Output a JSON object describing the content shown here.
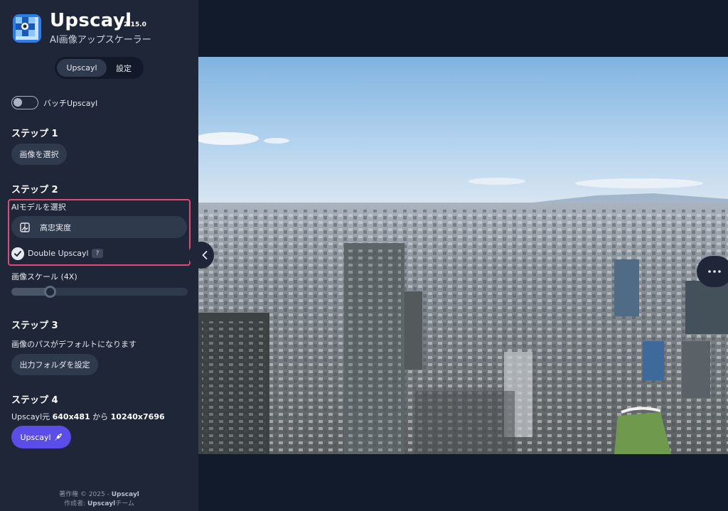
{
  "app": {
    "title": "Upscayl",
    "version": "2.15.0",
    "subtitle": "AI画像アップスケーラー"
  },
  "tabs": [
    {
      "label": "Upscayl",
      "active": true
    },
    {
      "label": "設定",
      "active": false
    }
  ],
  "batch": {
    "label": "バッチUpscayl",
    "enabled": false
  },
  "step1": {
    "title": "ステップ 1",
    "button": "画像を選択"
  },
  "step2": {
    "title": "ステップ 2",
    "model_label": "AIモデルを選択",
    "model_value": "高忠実度",
    "double_upscayl_label": "Double Upscayl",
    "double_upscayl_checked": true,
    "help_badge": "?",
    "scale_label": "画像スケール (4X)",
    "scale_fraction": 0.2
  },
  "step3": {
    "title": "ステップ 3",
    "description": "画像のパスがデフォルトになります",
    "button": "出力フォルダを設定"
  },
  "step4": {
    "title": "ステップ 4",
    "prefix": "Upscayl元 ",
    "from": "640x481",
    "middle": " から ",
    "to": "10240x7696",
    "button": "Upscayl"
  },
  "footer": {
    "line1_prefix": "著作権 © 2025 - ",
    "line1_brand": "Upscayl",
    "line2_prefix": "作成者: ",
    "line2_brand": "Upscayl",
    "line2_suffix": "チーム"
  },
  "icons": {
    "logo": "upscayl-logo-icon",
    "model": "model-image-icon",
    "check": "checkmark-icon",
    "rocket": "rocket-icon",
    "collapse": "chevron-left-icon",
    "more": "ellipsis-icon"
  },
  "colors": {
    "sidebar": "#1e2637",
    "main_bg": "#111b2c",
    "accent": "#5a4de8",
    "highlight": "#e04a73"
  }
}
